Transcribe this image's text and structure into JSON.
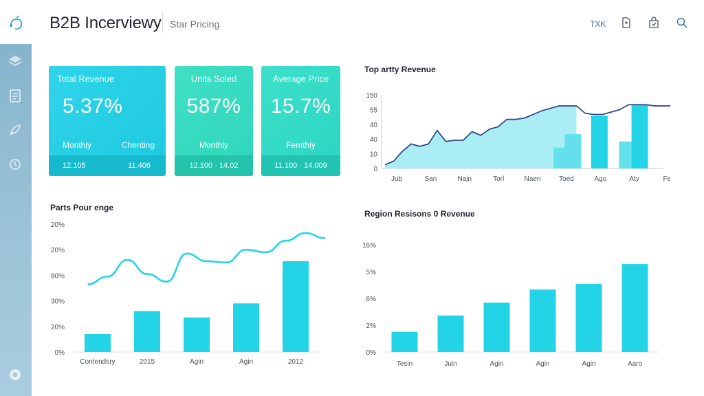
{
  "header": {
    "title": "B2B Incerviewy",
    "subtitle": "Star Pricing",
    "link": "TXK"
  },
  "kpis": [
    {
      "title": "Total Revenue",
      "value": "5.37%",
      "left_label": "Monthly",
      "right_label": "Chenting",
      "foot_left": "12.105",
      "foot_right": "11.406"
    },
    {
      "title": "Units Soled",
      "value": "587%",
      "left_label": "Monthly",
      "foot": "12.100 · 14.02"
    },
    {
      "title": "Average Price",
      "value": "15.7%",
      "left_label": "Femthly",
      "foot": "11.100 · 14.009"
    }
  ],
  "colors": {
    "cyan": "#22d4e6",
    "teal": "#3ee0bf",
    "light_cyan": "#a6ecf3",
    "navy": "#2e4a86"
  },
  "chart_data": [
    {
      "type": "area",
      "title": "Top artty Revenue",
      "categories": [
        "Jub",
        "San",
        "Najn",
        "Torl",
        "Naen",
        "Toed",
        "Ago",
        "Aty",
        "Fer"
      ],
      "yticks": [
        "0",
        "10",
        "40",
        "40",
        "55",
        "150"
      ],
      "ylim": [
        0,
        60
      ],
      "area_series": {
        "x": [
          0,
          0.25,
          0.5,
          0.75,
          1,
          1.25,
          1.5,
          1.75,
          2,
          2.25,
          2.5,
          2.75,
          3,
          3.25,
          3.5,
          3.75,
          4,
          4.25,
          4.5,
          4.75,
          5,
          5.25,
          5.5
        ],
        "values": [
          3,
          6,
          14,
          20,
          18,
          20,
          31,
          22,
          23,
          23,
          30,
          27,
          32,
          34,
          40,
          40,
          40,
          44,
          47,
          49,
          51,
          51,
          51
        ]
      },
      "line_series": {
        "x": [
          0,
          0.25,
          0.5,
          0.75,
          1,
          1.25,
          1.5,
          1.75,
          2,
          2.25,
          2.5,
          2.75,
          3,
          3.25,
          3.5,
          3.75,
          4,
          4.25,
          4.5,
          4.75,
          5,
          5.25,
          5.5,
          5.75,
          6,
          6.25,
          6.5,
          6.75,
          7,
          7.25,
          7.5,
          7.75,
          8,
          8.25
        ],
        "values": [
          3,
          6,
          14,
          20,
          18,
          20,
          31,
          22,
          23,
          23,
          30,
          27,
          32,
          34,
          40,
          40,
          41,
          44,
          47,
          49,
          51,
          51,
          51,
          45,
          44,
          44,
          46,
          48,
          52,
          52,
          52,
          51,
          51,
          51
        ]
      },
      "bars": [
        {
          "x": 6.35,
          "value": 17
        },
        {
          "x": 6.75,
          "value": 28
        },
        {
          "x": 7.7,
          "value": 43
        },
        {
          "x": 8.7,
          "value": 22
        },
        {
          "x": 9.15,
          "value": 52
        }
      ]
    },
    {
      "type": "bar",
      "title": "Parts Pour enge",
      "categories": [
        "Contendsry",
        "2015",
        "Agin",
        "Agin",
        "2012"
      ],
      "yticks": [
        "0%",
        "20%",
        "30%",
        "80%",
        "20%",
        "20%"
      ],
      "ylim": [
        0,
        100
      ],
      "values": [
        14,
        32,
        27,
        38,
        71
      ],
      "line": {
        "x": [
          -0.2,
          0.2,
          0.6,
          1.0,
          1.4,
          1.8,
          2.2,
          2.6,
          3.0,
          3.4,
          3.8,
          4.2,
          4.6
        ],
        "values": [
          53,
          59,
          72,
          61,
          55,
          77,
          71,
          70,
          80,
          78,
          87,
          93,
          89
        ]
      }
    },
    {
      "type": "bar",
      "title": "Region Resisons 0 Revenue",
      "categories": [
        "Tesin",
        "Juin",
        "Agin",
        "Agin",
        "Agin",
        "Aaro"
      ],
      "yticks": [
        "0%",
        "2%",
        "6%",
        "5%",
        "16%"
      ],
      "ylim": [
        0,
        4
      ],
      "values": [
        0.75,
        1.36,
        1.84,
        2.33,
        2.54,
        3.28
      ]
    }
  ]
}
